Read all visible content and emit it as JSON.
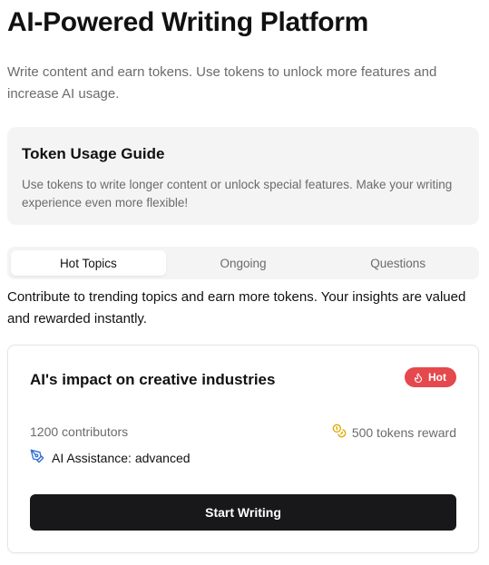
{
  "header": {
    "title": "AI-Powered Writing Platform",
    "subtitle": "Write content and earn tokens. Use tokens to unlock more features and increase AI usage."
  },
  "guide": {
    "title": "Token Usage Guide",
    "text": "Use tokens to write longer content or unlock special features. Make your writing experience even more flexible!"
  },
  "tabs": [
    {
      "label": "Hot Topics",
      "active": true
    },
    {
      "label": "Ongoing",
      "active": false
    },
    {
      "label": "Questions",
      "active": false
    }
  ],
  "description": "Contribute to trending topics and earn more tokens. Your insights are valued and rewarded instantly.",
  "topic": {
    "title": "AI's impact on creative industries",
    "badge": "Hot",
    "contributors": "1200 contributors",
    "reward": "500 tokens reward",
    "assistance": "AI Assistance: advanced",
    "button_label": "Start Writing"
  },
  "icons": {
    "badge": "flame-icon",
    "reward": "coins-icon",
    "assistance": "pen-tool-icon"
  },
  "colors": {
    "hot_badge": "#e5484d",
    "coin": "#e0a800",
    "assist_icon": "#2f6fd6",
    "button": "#18181b"
  }
}
